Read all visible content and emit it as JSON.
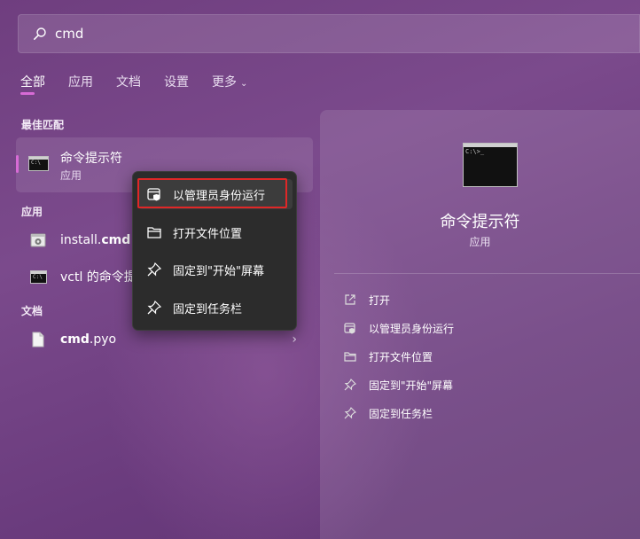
{
  "search": {
    "value": "cmd"
  },
  "tabs": [
    {
      "label": "全部",
      "active": true
    },
    {
      "label": "应用"
    },
    {
      "label": "文档"
    },
    {
      "label": "设置"
    },
    {
      "label": "更多"
    }
  ],
  "sections": {
    "best_match": "最佳匹配",
    "apps": "应用",
    "docs": "文档"
  },
  "best_match": {
    "title": "命令提示符",
    "subtitle": "应用"
  },
  "apps": [
    {
      "prefix": "install.",
      "bold": "cmd",
      "icon": "setup-icon"
    },
    {
      "text": "vctl 的命令提",
      "icon": "cmd-icon"
    }
  ],
  "docs": [
    {
      "bold": "cmd",
      "suffix": ".pyo",
      "icon": "file-icon"
    }
  ],
  "context_menu": [
    {
      "label": "以管理员身份运行",
      "icon": "shield-icon"
    },
    {
      "label": "打开文件位置",
      "icon": "folder-icon"
    },
    {
      "label": "固定到\"开始\"屏幕",
      "icon": "pin-icon"
    },
    {
      "label": "固定到任务栏",
      "icon": "pin-icon"
    }
  ],
  "preview": {
    "title": "命令提示符",
    "subtitle": "应用",
    "actions": [
      {
        "label": "打开",
        "icon": "open-icon"
      },
      {
        "label": "以管理员身份运行",
        "icon": "shield-icon"
      },
      {
        "label": "打开文件位置",
        "icon": "folder-icon"
      },
      {
        "label": "固定到\"开始\"屏幕",
        "icon": "pin-icon"
      },
      {
        "label": "固定到任务栏",
        "icon": "pin-icon"
      }
    ]
  },
  "colors": {
    "accent": "#d86bd6",
    "highlight_border": "#e02727",
    "menu_bg": "#2c2c2c"
  }
}
